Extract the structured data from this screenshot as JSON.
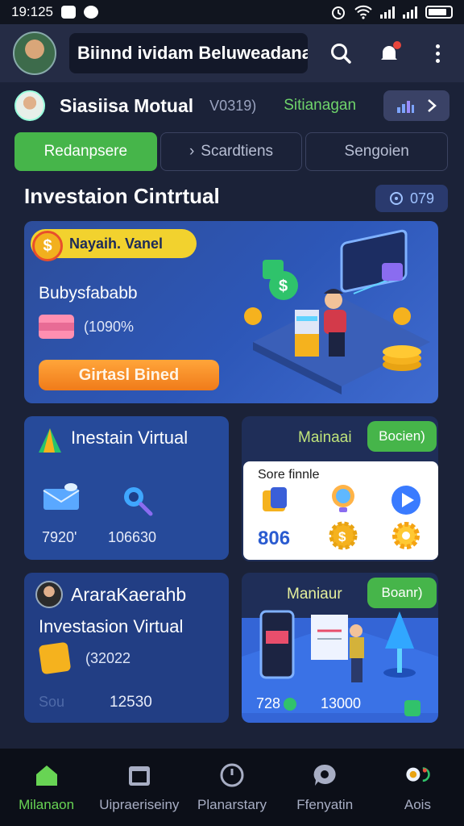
{
  "status_bar": {
    "time": "19:125"
  },
  "app_bar": {
    "title": "Biinnd ividam Beluweadana"
  },
  "profile": {
    "name": "Siasiisa Motual",
    "code": "V0319)",
    "status": "Sitianagan"
  },
  "tabs": [
    {
      "label": "Redanpsere",
      "active": true
    },
    {
      "label": "Scardtiens",
      "active": false
    },
    {
      "label": "Sengoien",
      "active": false
    }
  ],
  "section": {
    "title": "Investaion Cintrtual",
    "badge": "079"
  },
  "hero": {
    "tag": "Nayaih. Vanel",
    "subtitle": "Bubysfababb",
    "rate": "(1090%",
    "cta": "Girtasl Bined"
  },
  "card1": {
    "title": "Inestain Virtual",
    "value1": "7920'",
    "value2": "106630"
  },
  "card2": {
    "title": "Mainaai",
    "pill": "Bocien)",
    "panel_label": "Sore finnle",
    "panel_number": "806"
  },
  "card3": {
    "title": "AraraKaerahb",
    "subtitle": "Investasion Virtual",
    "code": "(32022",
    "faded": "Sou",
    "value": "12530"
  },
  "card4": {
    "title": "Maniaur",
    "pill": "Boanr)",
    "value1": "728",
    "value2": "13000"
  },
  "bottom_nav": [
    {
      "label": "Milanaon",
      "icon": "home-icon",
      "active": true
    },
    {
      "label": "Uipraeriseiny",
      "icon": "calendar-icon",
      "active": false
    },
    {
      "label": "Planarstary",
      "icon": "clock-icon",
      "active": false
    },
    {
      "label": "Ffenyatin",
      "icon": "chat-icon",
      "active": false
    },
    {
      "label": "Aois",
      "icon": "alert-icon",
      "active": false
    }
  ],
  "colors": {
    "accent_green": "#46b54a",
    "background": "#1b2238",
    "card_blue": "#264a9a"
  }
}
